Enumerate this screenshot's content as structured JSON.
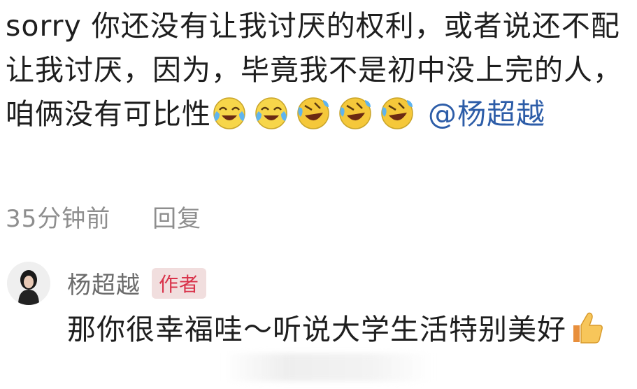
{
  "comment": {
    "text": "sorry 你还没有让我讨厌的权利，或者说还不配让我讨厌，因为，毕竟我不是初中没上完的人，咱俩没有可比性",
    "mention": "@杨超越",
    "emojis": [
      "laugh-cry-icon",
      "laugh-cry-icon",
      "rofl-icon",
      "rofl-icon",
      "rofl-icon"
    ],
    "time": "35分钟前",
    "reply_label": "回复"
  },
  "reply": {
    "author": "杨超越",
    "badge": "作者",
    "text": "那你很幸福哇～听说大学生活特别美好",
    "emoji": "thumbs-up-icon"
  },
  "colors": {
    "mention": "#2d5da8",
    "badge_text": "#d9324a",
    "badge_bg": "#f1dede",
    "meta": "#8e8e8e"
  }
}
